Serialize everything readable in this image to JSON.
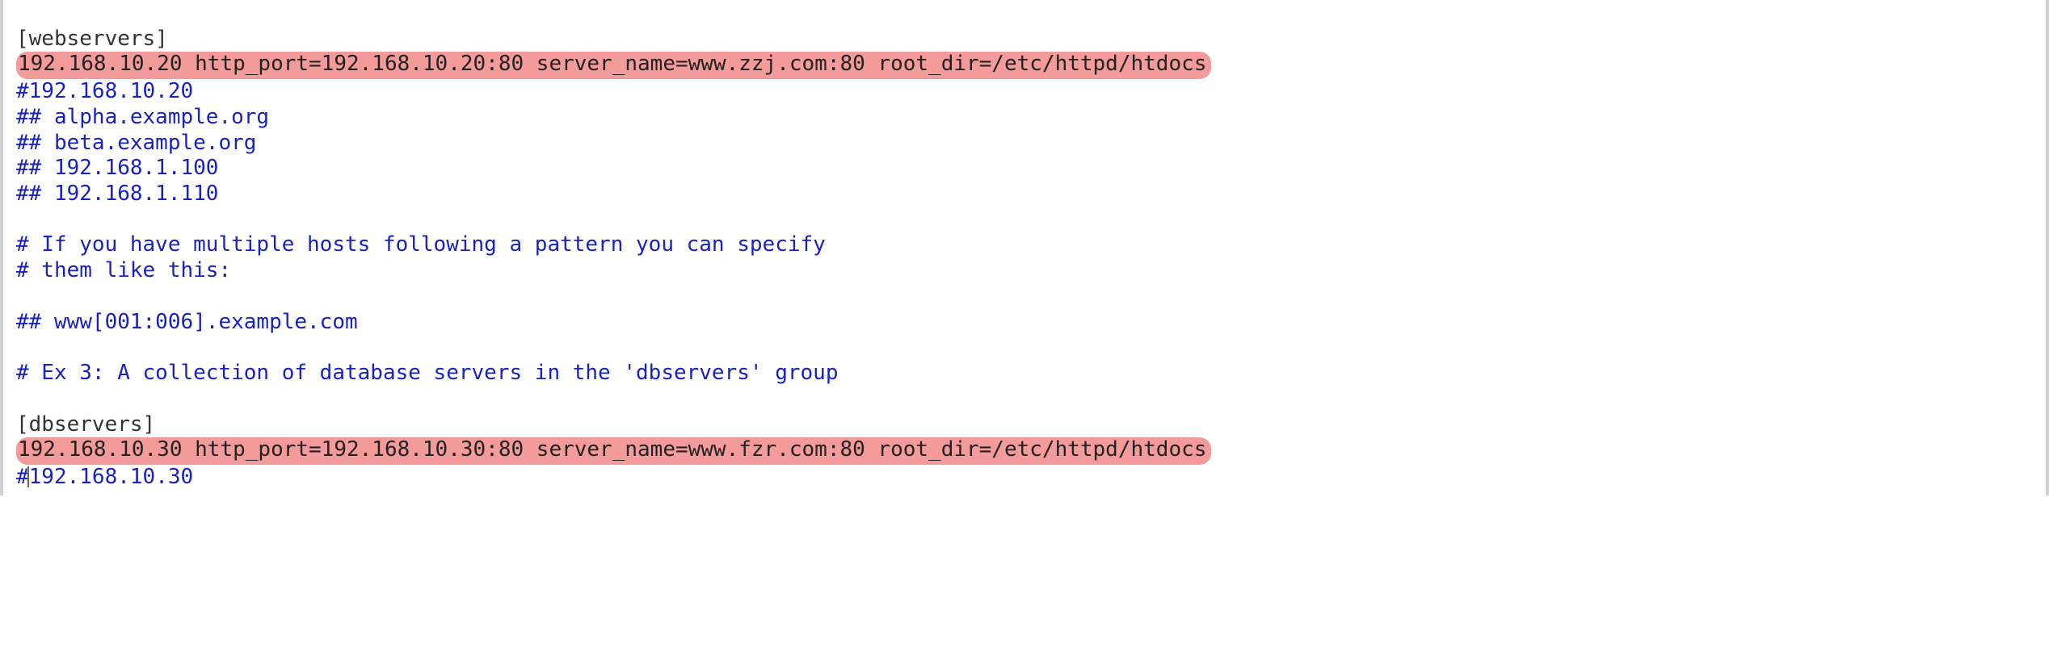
{
  "lines": {
    "l1": "[webservers]",
    "l2": "192.168.10.20 http_port=192.168.10.20:80 server_name=www.zzj.com:80 root_dir=/etc/httpd/htdocs",
    "l3": "#192.168.10.20",
    "l4": "## alpha.example.org",
    "l5": "## beta.example.org",
    "l6": "## 192.168.1.100",
    "l7": "## 192.168.1.110",
    "l8": "",
    "l9": "# If you have multiple hosts following a pattern you can specify",
    "l10": "# them like this:",
    "l11": "",
    "l12": "## www[001:006].example.com",
    "l13": "",
    "l14": "# Ex 3: A collection of database servers in the 'dbservers' group",
    "l15": "",
    "l16": "[dbservers]",
    "l17": "192.168.10.30 http_port=192.168.10.30:80 server_name=www.fzr.com:80 root_dir=/etc/httpd/htdocs",
    "l18a": "#",
    "l18b": "192.168.10.30"
  }
}
